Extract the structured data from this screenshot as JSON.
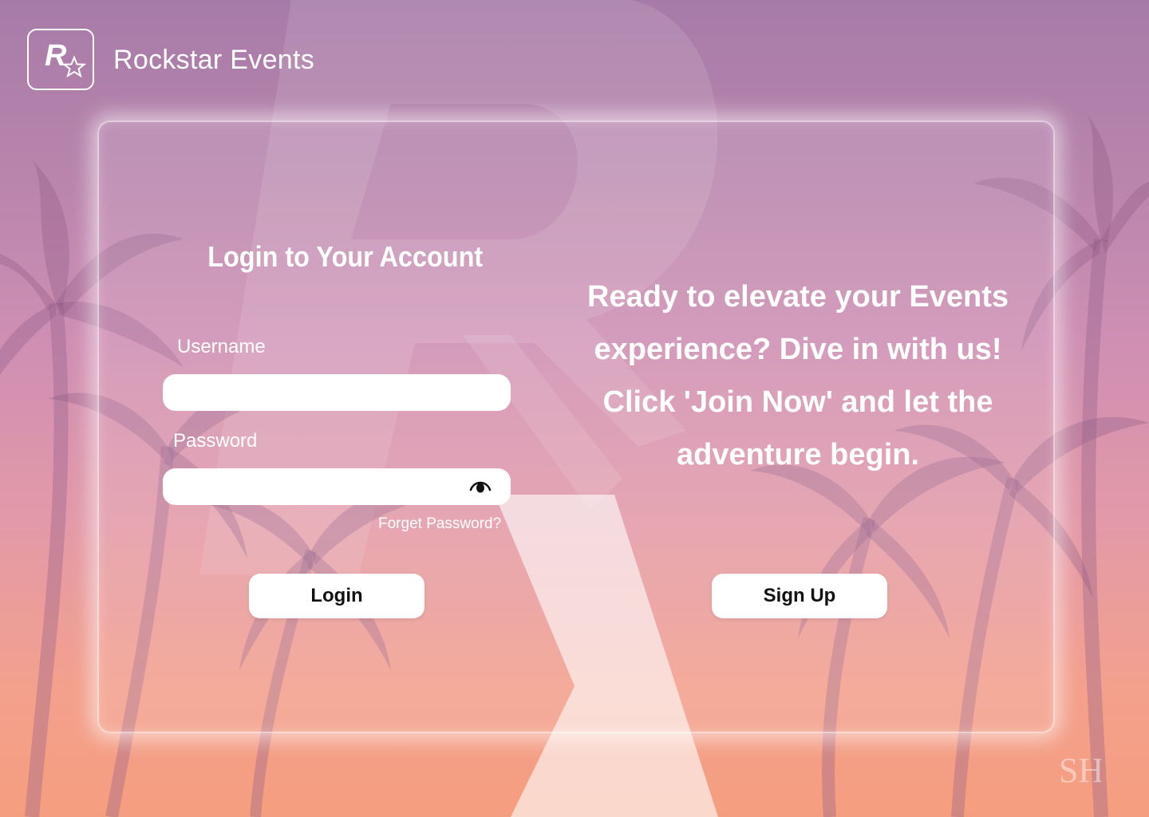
{
  "brand": {
    "logo_text": "R",
    "name": "Rockstar Events"
  },
  "login": {
    "title": "Login to Your Account",
    "username_label": "Username",
    "username_value": "",
    "password_label": "Password",
    "password_value": "",
    "show_password_icon": "eye-icon",
    "forgot_password": "Forget Password?",
    "login_button": "Login"
  },
  "promo": {
    "text": "Ready to elevate your Events experience? Dive in with us! Click 'Join Now' and let the adventure begin.",
    "signup_button": "Sign Up"
  },
  "watermark": {
    "text": "SH"
  },
  "colors": {
    "gradient_top": "#a77ba8",
    "gradient_mid": "#cf8fb3",
    "gradient_bottom": "#f59e7f",
    "text": "#ffffff",
    "button_bg": "#ffffff",
    "button_text": "#111111"
  }
}
